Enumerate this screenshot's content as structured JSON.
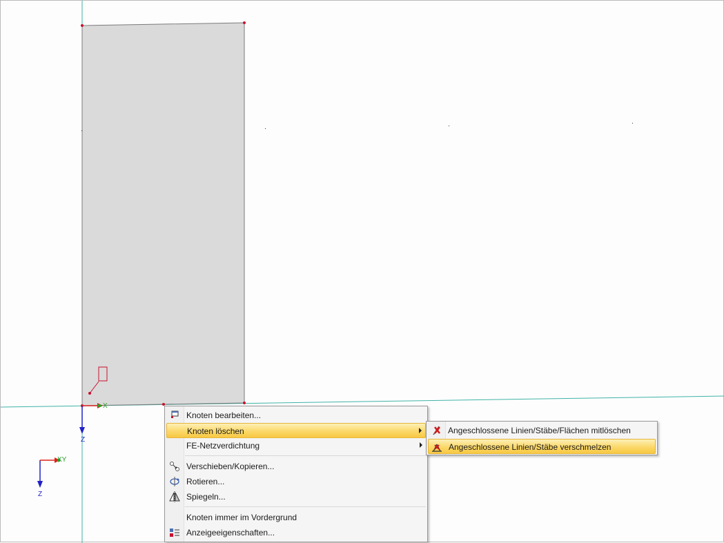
{
  "axes": {
    "local_x": "X",
    "local_y": "Y",
    "local_z": "Z",
    "global_x": "X",
    "global_y": "Y",
    "global_z": "Z"
  },
  "context_menu": {
    "items": [
      {
        "label": "Knoten bearbeiten...",
        "icon": "edit-node-icon"
      },
      {
        "label": "Knoten löschen",
        "icon": "",
        "submenu": true,
        "highlighted": true
      },
      {
        "label": "FE-Netzverdichtung",
        "icon": "",
        "submenu": true
      },
      {
        "label": "Verschieben/Kopieren...",
        "icon": "move-copy-icon"
      },
      {
        "label": "Rotieren...",
        "icon": "rotate-icon"
      },
      {
        "label": "Spiegeln...",
        "icon": "mirror-icon"
      },
      {
        "label": "Knoten immer im Vordergrund",
        "icon": ""
      },
      {
        "label": "Anzeigeeigenschaften...",
        "icon": "display-properties-icon"
      }
    ]
  },
  "submenu": {
    "items": [
      {
        "label": "Angeschlossene Linien/Stäbe/Flächen mitlöschen",
        "icon": "delete-with-connected-icon"
      },
      {
        "label": "Angeschlossene Linien/Stäbe verschmelzen",
        "icon": "merge-lines-icon",
        "highlighted": true
      }
    ]
  },
  "colors": {
    "surface_fill": "#dadada",
    "node": "#c8102e",
    "guide_line": "#2aa89a",
    "axis_x": "#e0201b",
    "axis_y": "#28a428",
    "axis_z": "#2020c8",
    "highlight": "#fbd86a"
  }
}
